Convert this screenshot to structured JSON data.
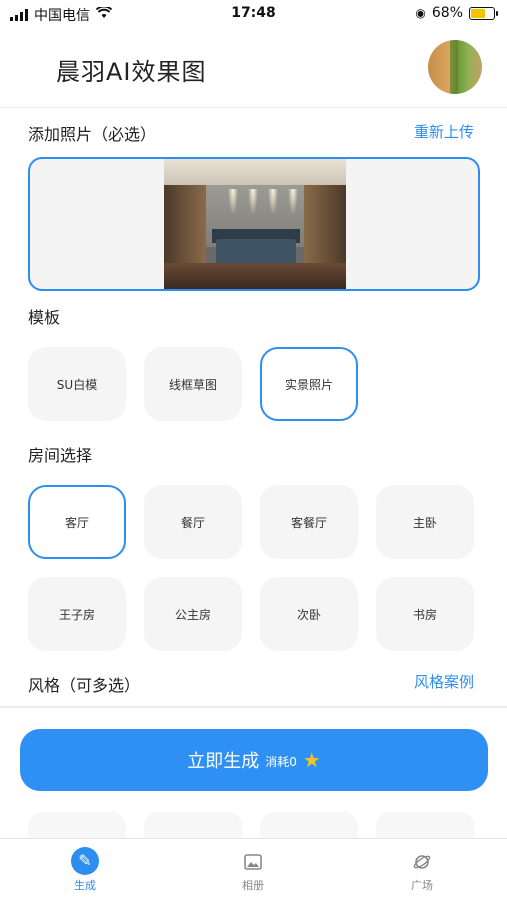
{
  "status_bar": {
    "carrier": "中国电信",
    "time": "17:48",
    "battery_percent": "68%",
    "battery_level": 0.68
  },
  "header": {
    "title": "晨羽AI效果图"
  },
  "photo_section": {
    "title": "添加照片（必选）",
    "reupload_label": "重新上传"
  },
  "template_section": {
    "title": "模板",
    "options": [
      "SU白模",
      "线框草图",
      "实景照片"
    ],
    "selected": "实景照片"
  },
  "room_section": {
    "title": "房间选择",
    "options": [
      "客厅",
      "餐厅",
      "客餐厅",
      "主卧",
      "王子房",
      "公主房",
      "次卧",
      "书房"
    ],
    "selected": "客厅"
  },
  "style_section": {
    "title": "风格（可多选）",
    "cases_label": "风格案例"
  },
  "generate_button": {
    "label": "立即生成",
    "cost": "消耗0",
    "icon": "sparkle-star-icon"
  },
  "tabbar": {
    "items": [
      {
        "label": "生成",
        "icon": "brush-icon",
        "active": true
      },
      {
        "label": "相册",
        "icon": "album-icon",
        "active": false
      },
      {
        "label": "广场",
        "icon": "planet-icon",
        "active": false
      }
    ]
  },
  "colors": {
    "accent": "#2e8ef0",
    "chip_bg": "#f5f5f5",
    "star": "#f7c321"
  }
}
